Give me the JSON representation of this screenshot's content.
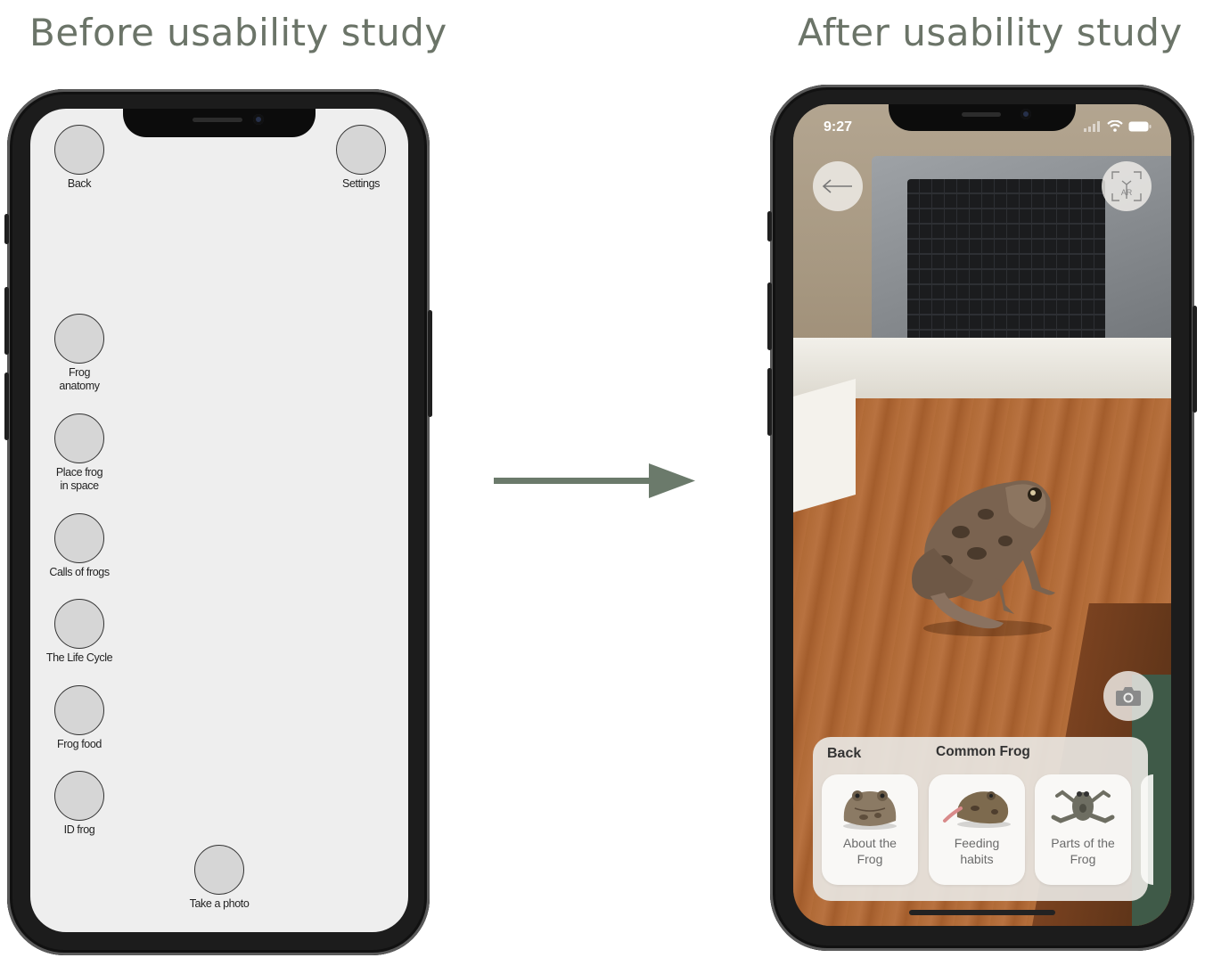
{
  "headings": {
    "before": "Before usability study",
    "after": "After usability study"
  },
  "wireframe": {
    "back": "Back",
    "settings": "Settings",
    "menu": [
      {
        "label": "Frog\nanatomy"
      },
      {
        "label": "Place frog\nin space"
      },
      {
        "label": "Calls of frogs"
      },
      {
        "label": "The Life Cycle"
      },
      {
        "label": "Frog food"
      },
      {
        "label": "ID frog"
      }
    ],
    "take_photo": "Take a photo"
  },
  "ar_app": {
    "status_time": "9:27",
    "ar_badge": "AR",
    "panel": {
      "back": "Back",
      "title": "Common Frog",
      "cards": [
        {
          "label": "About the\nFrog"
        },
        {
          "label": "Feeding\nhabits"
        },
        {
          "label": "Parts of the\nFrog"
        }
      ]
    }
  },
  "colors": {
    "heading": "#6b7468",
    "arrow": "#6b7a6b"
  }
}
